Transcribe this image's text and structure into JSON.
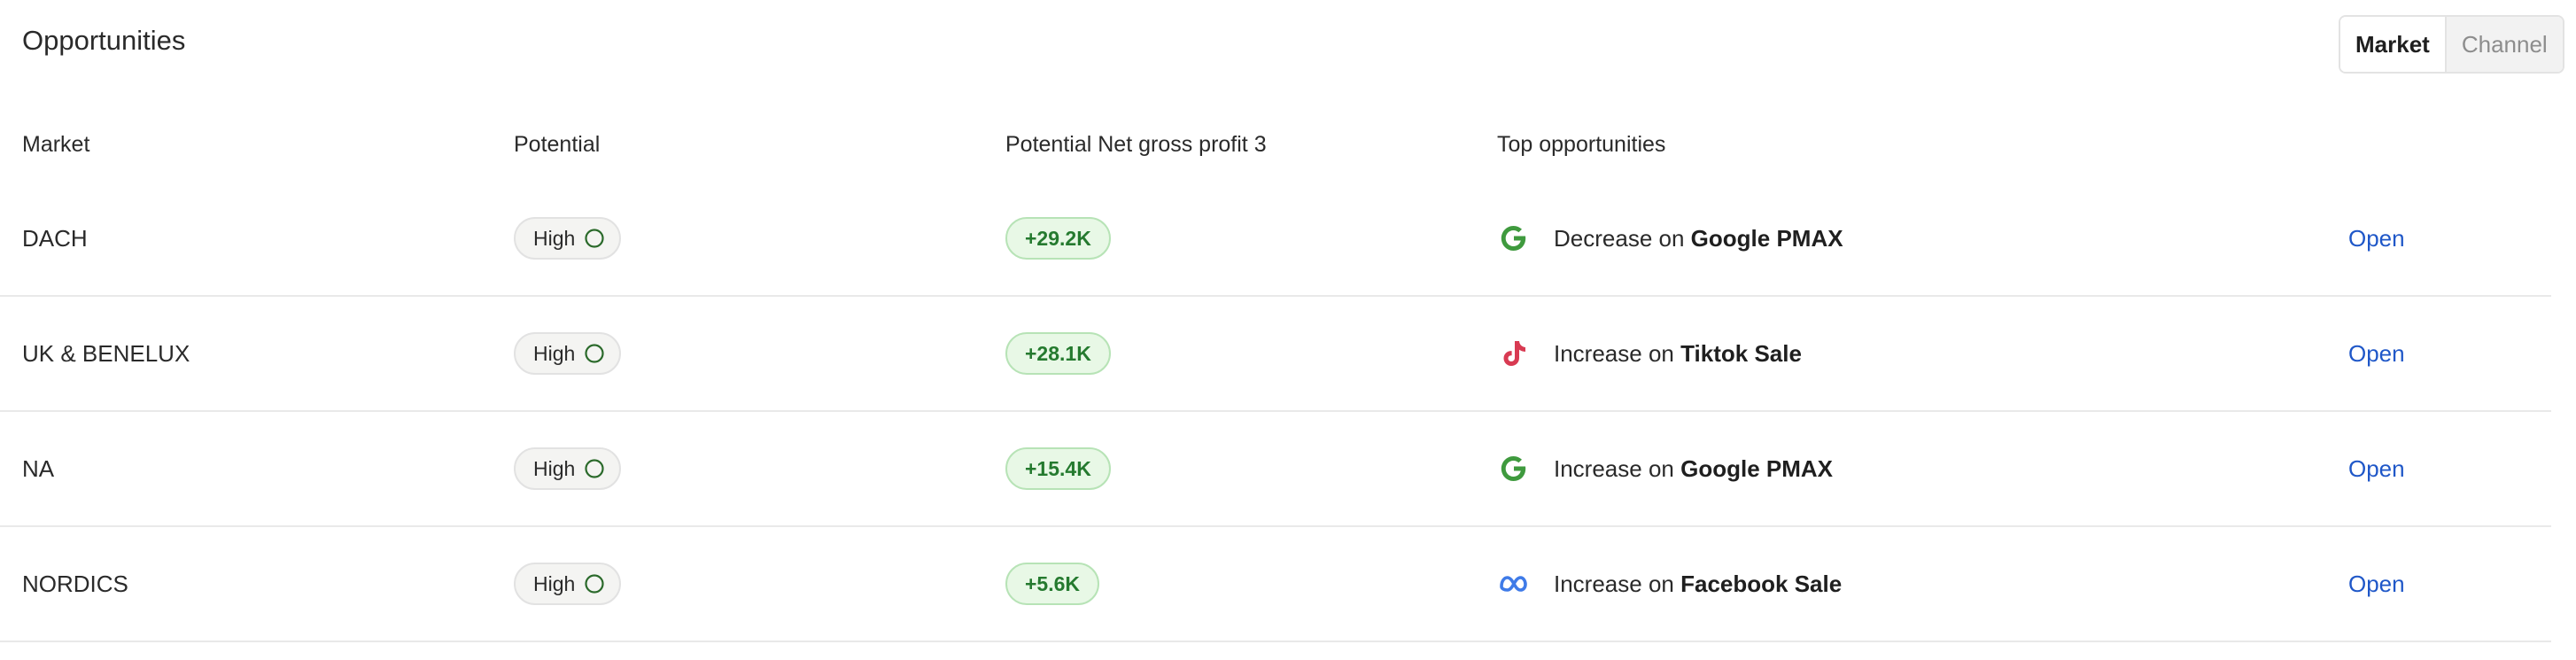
{
  "header": {
    "title": "Opportunities",
    "toggle": [
      "Market",
      "Channel"
    ]
  },
  "table": {
    "columns": [
      "Market",
      "Potential",
      "Potential Net gross profit 3",
      "Top opportunities"
    ],
    "rows": [
      {
        "market": "DACH",
        "potential": "High",
        "profit": "+29.2K",
        "top_icon": "google-icon",
        "action": "Decrease",
        "connector": "on",
        "channel": "Google PMAX",
        "open": "Open"
      },
      {
        "market": "UK & BENELUX",
        "potential": "High",
        "profit": "+28.1K",
        "top_icon": "tiktok-icon",
        "action": "Increase",
        "connector": "on",
        "channel": "Tiktok Sale",
        "open": "Open"
      },
      {
        "market": "NA",
        "potential": "High",
        "profit": "+15.4K",
        "top_icon": "google-icon",
        "action": "Increase",
        "connector": "on",
        "channel": "Google PMAX",
        "open": "Open"
      },
      {
        "market": "NORDICS",
        "potential": "High",
        "profit": "+5.6K",
        "top_icon": "meta-icon",
        "action": "Increase",
        "connector": "on",
        "channel": "Facebook Sale",
        "open": "Open"
      }
    ]
  },
  "colors": {
    "accent_link": "#1f57c8",
    "profit_text": "#257a2f",
    "profit_bg": "#e8f8e6",
    "google_green": "#3f9a3e",
    "tiktok_red": "#d83a52",
    "meta_blue": "#3f7be8"
  }
}
